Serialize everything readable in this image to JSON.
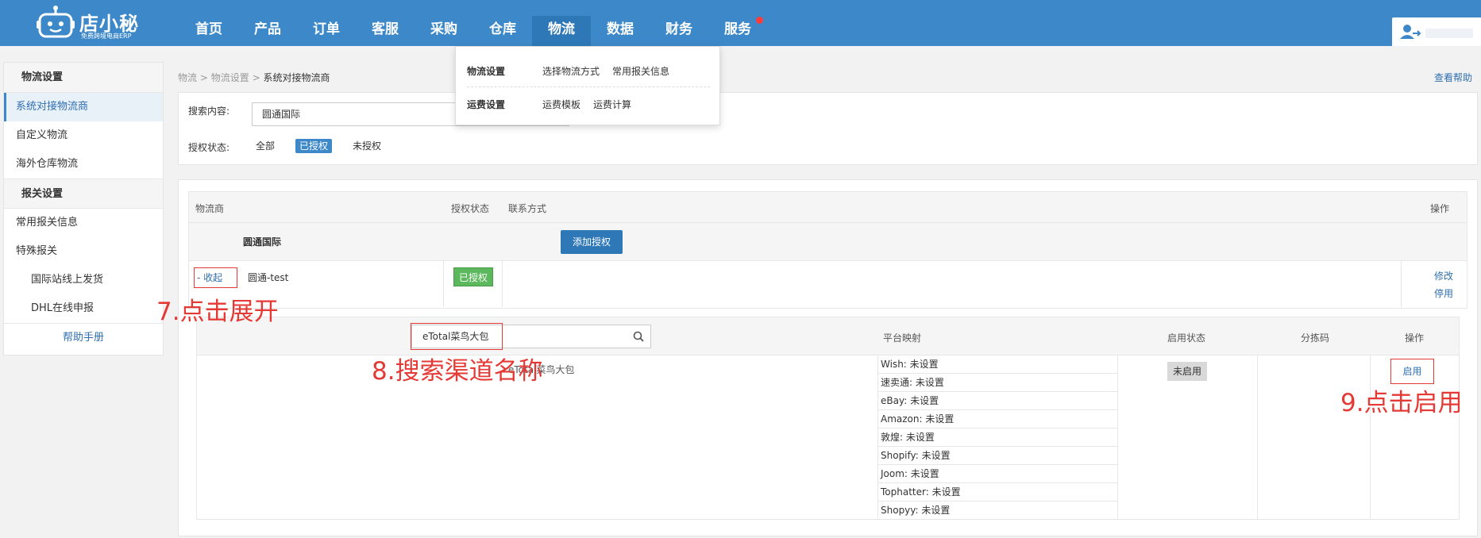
{
  "header": {
    "brand": "店小秘",
    "slogan": "免费跨境电商ERP",
    "nav": [
      "首页",
      "产品",
      "订单",
      "客服",
      "采购",
      "仓库",
      "物流",
      "数据",
      "财务",
      "服务"
    ],
    "active_nav": "物流",
    "accent": "#3d88c8"
  },
  "dropdown": {
    "rows": [
      {
        "group": "物流设置",
        "options": [
          "选择物流方式",
          "常用报关信息"
        ]
      },
      {
        "group": "运费设置",
        "options": [
          "运费模板",
          "运费计算"
        ]
      }
    ]
  },
  "sidebar": {
    "sections": [
      {
        "title": "物流设置",
        "items": [
          "系统对接物流商",
          "自定义物流",
          "海外仓库物流"
        ]
      },
      {
        "title": "报关设置",
        "items": [
          "常用报关信息",
          "特殊报关"
        ],
        "sub_items": [
          "国际站线上发货",
          "DHL在线申报"
        ]
      }
    ],
    "active_item": "系统对接物流商",
    "help": "帮助手册"
  },
  "breadcrumb": {
    "items": [
      "物流",
      "物流设置"
    ],
    "current": "系统对接物流商",
    "sep": ">"
  },
  "help_link": "查看帮助",
  "search": {
    "content_label": "搜索内容:",
    "content_value": "圆通国际",
    "auth_label": "授权状态:",
    "auth_options": [
      "全部",
      "已授权",
      "未授权"
    ],
    "auth_selected": "已授权"
  },
  "table": {
    "headers": {
      "provider": "物流商",
      "auth_status": "授权状态",
      "contact": "联系方式",
      "action": "操作"
    },
    "group": {
      "name": "圆通国际",
      "add_button": "添加授权"
    },
    "row": {
      "toggle": "- 收起",
      "name": "圆通-test",
      "status": "已授权",
      "actions": [
        "修改",
        "停用"
      ]
    }
  },
  "channels": {
    "search_value": "eTotal菜鸟大包",
    "headers": {
      "mapping": "平台映射",
      "enable_status": "启用状态",
      "sort_code": "分拣码",
      "action": "操作"
    },
    "channel_name": "eTotal菜鸟大包",
    "mappings": [
      {
        "platform": "Wish:",
        "value": "未设置"
      },
      {
        "platform": "速卖通:",
        "value": "未设置"
      },
      {
        "platform": "eBay:",
        "value": "未设置"
      },
      {
        "platform": "Amazon:",
        "value": "未设置"
      },
      {
        "platform": "敦煌:",
        "value": "未设置"
      },
      {
        "platform": "Shopify:",
        "value": "未设置"
      },
      {
        "platform": "Joom:",
        "value": "未设置"
      },
      {
        "platform": "Tophatter:",
        "value": "未设置"
      },
      {
        "platform": "Shopyy:",
        "value": "未设置"
      }
    ],
    "enable_status": "未启用",
    "enable_action": "启用"
  },
  "annotations": {
    "step7": "7.点击展开",
    "step8": "8.搜索渠道名称",
    "step9": "9.点击启用",
    "color": "#e53935"
  }
}
